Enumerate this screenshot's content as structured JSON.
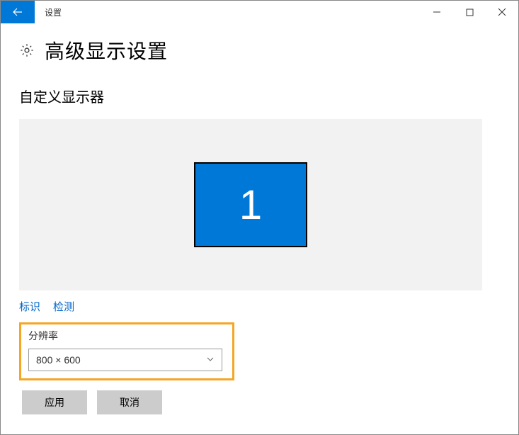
{
  "titlebar": {
    "title": "设置"
  },
  "page": {
    "title": "高级显示设置"
  },
  "section": {
    "title": "自定义显示器"
  },
  "monitor": {
    "label": "1"
  },
  "links": {
    "identify": "标识",
    "detect": "检测"
  },
  "resolution": {
    "label": "分辨率",
    "value": "800 × 600"
  },
  "buttons": {
    "apply": "应用",
    "cancel": "取消"
  }
}
